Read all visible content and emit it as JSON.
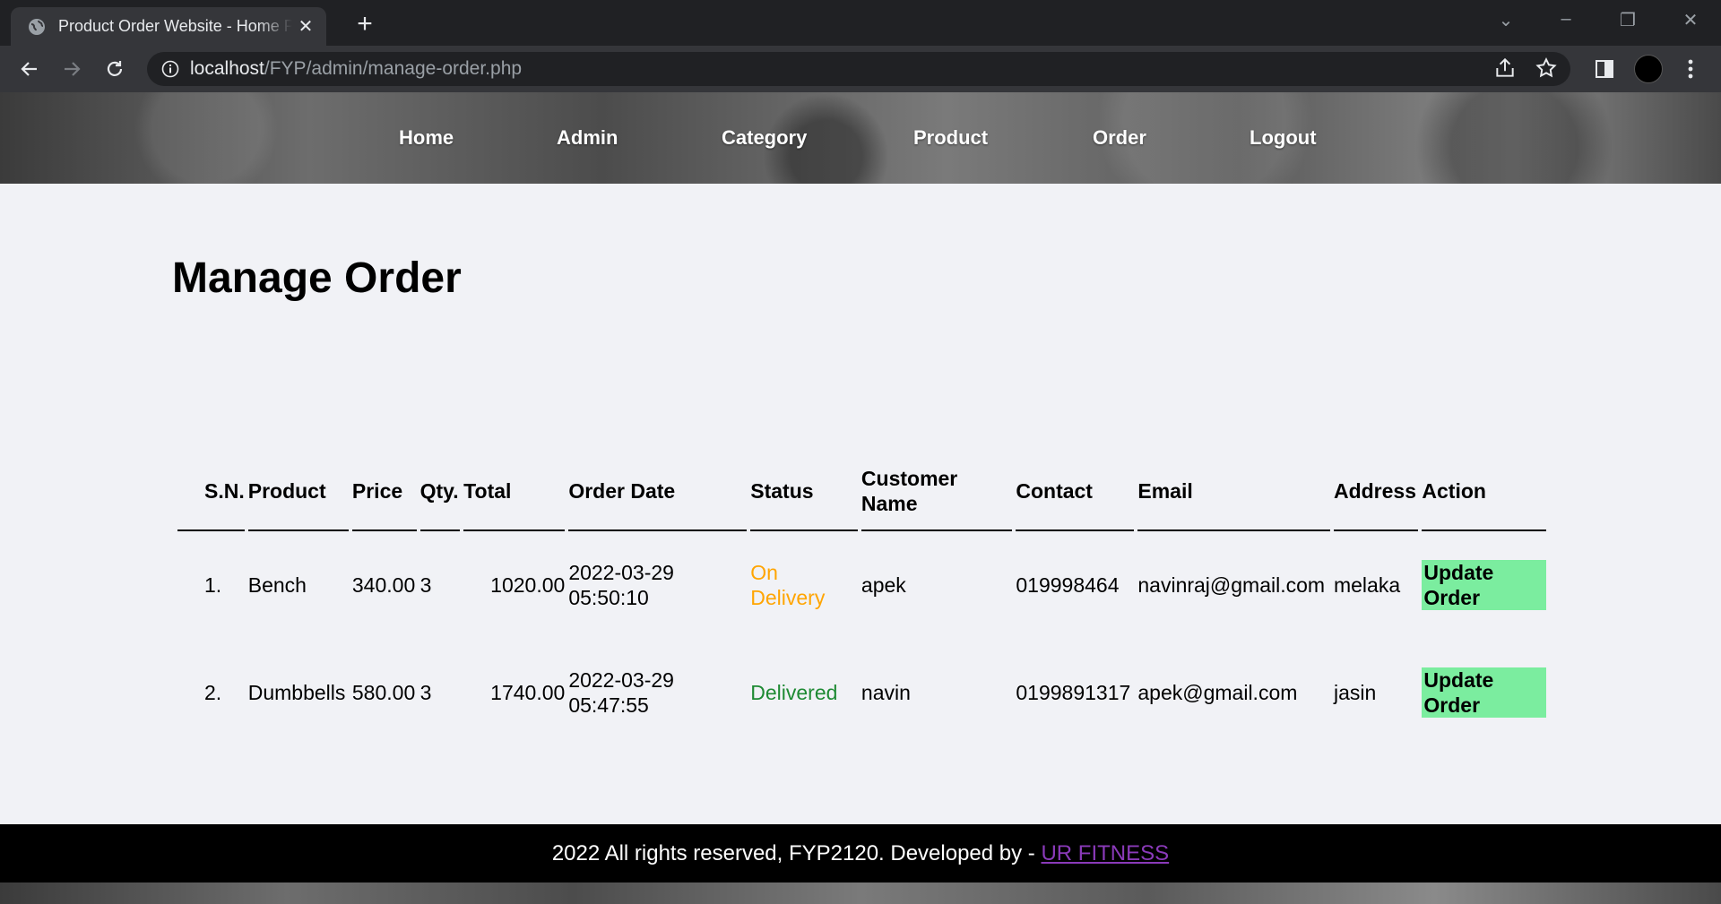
{
  "browser": {
    "tab_title": "Product Order Website - Home Page",
    "url_host": "localhost",
    "url_path": "/FYP/admin/manage-order.php"
  },
  "nav": {
    "items": [
      {
        "label": "Home"
      },
      {
        "label": "Admin"
      },
      {
        "label": "Category"
      },
      {
        "label": "Product"
      },
      {
        "label": "Order"
      },
      {
        "label": "Logout"
      }
    ]
  },
  "main": {
    "title": "Manage Order",
    "table": {
      "headers": {
        "sn": "S.N.",
        "product": "Product",
        "price": "Price",
        "qty": "Qty.",
        "total": "Total",
        "order_date": "Order Date",
        "status": "Status",
        "customer_name": "Customer Name",
        "contact": "Contact",
        "email": "Email",
        "address": "Address",
        "action": "Action"
      },
      "rows": [
        {
          "sn": "1.",
          "product": "Bench",
          "price": "340.00",
          "qty": "3",
          "total": "1020.00",
          "order_date": "2022-03-29 05:50:10",
          "status": "On Delivery",
          "customer_name": "apek",
          "contact": "019998464",
          "email": "navinraj@gmail.com",
          "address": "melaka",
          "action": "Update Order"
        },
        {
          "sn": "2.",
          "product": "Dumbbells",
          "price": "580.00",
          "qty": "3",
          "total": "1740.00",
          "order_date": "2022-03-29 05:47:55",
          "status": "Delivered",
          "customer_name": "navin",
          "contact": "0199891317",
          "email": "apek@gmail.com",
          "address": "jasin",
          "action": "Update Order"
        }
      ]
    }
  },
  "footer": {
    "text": "2022 All rights reserved, FYP2120. Developed by - ",
    "link": "UR FITNESS"
  },
  "colors": {
    "status_on_delivery": "#ffa502",
    "status_delivered": "#1e8a33",
    "update_button": "#7bed9f",
    "footer_link": "#8a3ab9"
  }
}
